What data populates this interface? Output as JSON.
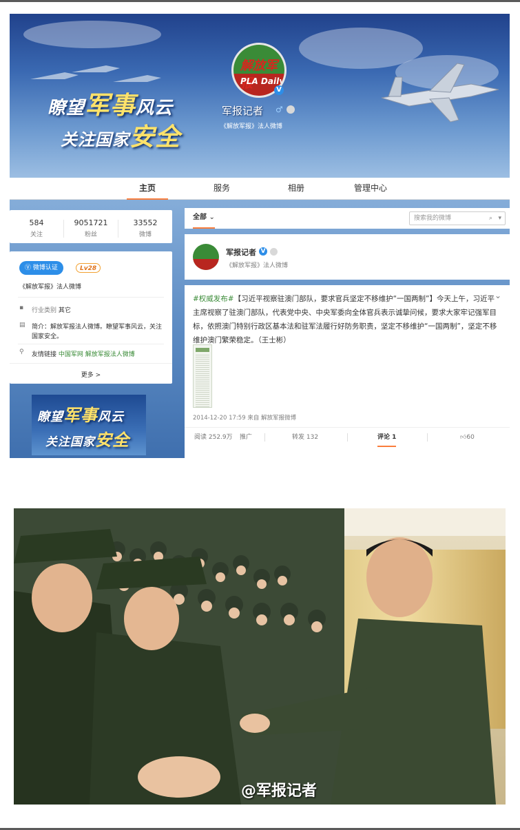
{
  "banner": {
    "slogan_line1_a": "瞭望",
    "slogan_line1_b": "军事",
    "slogan_line1_c": "风云",
    "slogan_line2_a": "关注国家",
    "slogan_line2_b": "安全",
    "logo_cn": "解放军报",
    "logo_en": "PLA Daily",
    "account_name": "军报记者",
    "account_desc": "《解放军报》法人微博",
    "gender_icon": "male-icon"
  },
  "nav": {
    "items": [
      "主页",
      "服务",
      "相册",
      "管理中心"
    ]
  },
  "stats": [
    {
      "num": "584",
      "label": "关注"
    },
    {
      "num": "9051721",
      "label": "粉丝"
    },
    {
      "num": "33552",
      "label": "微博"
    }
  ],
  "profile": {
    "verify_badge": "微博认证",
    "level_badge": "Lv28",
    "verify_desc": "《解放军报》法人微博",
    "industry_label": "行业类别",
    "industry_value": "其它",
    "intro_label": "简介：",
    "intro_text": "解放军报法人微博。瞭望军事风云，关注国家安全。",
    "links_label": "友情链接",
    "link1": "中国军网",
    "link2": "解放军报法人微博",
    "more": "更多 >"
  },
  "ad": {
    "line1_a": "瞭望",
    "line1_b": "军事",
    "line1_c": "风云",
    "line2_a": "关注国家",
    "line2_b": "安全"
  },
  "feed": {
    "filter_label": "全部",
    "search_placeholder": "搜索我的微博"
  },
  "post": {
    "author": "军报记者",
    "author_desc": "《解放军报》法人微博",
    "tag": "#权威发布#",
    "text": "【习近平视察驻澳门部队，要求官兵坚定不移维护“一国两制”】今天上午，习近平主席视察了驻澳门部队，代表党中央、中央军委向全体官兵表示诚挚问候，要求大家牢记强军目标，依照澳门特别行政区基本法和驻军法履行好防务职责，坚定不移维护“一国两制”，坚定不移维护澳门繁荣稳定。（王士彬）",
    "timestamp": "2014-12-20 17:59",
    "source_prefix": "来自",
    "source": "解放军报微博",
    "reads": "阅读 252.9万",
    "promote": "推广",
    "reposts": "转发 132",
    "comments": "评论 1",
    "likes": "60"
  },
  "photo": {
    "watermark": "@军报记者"
  },
  "colors": {
    "accent_orange": "#fa7d3c",
    "verify_blue": "#2d8ee8",
    "link_green": "#3a8b37"
  }
}
